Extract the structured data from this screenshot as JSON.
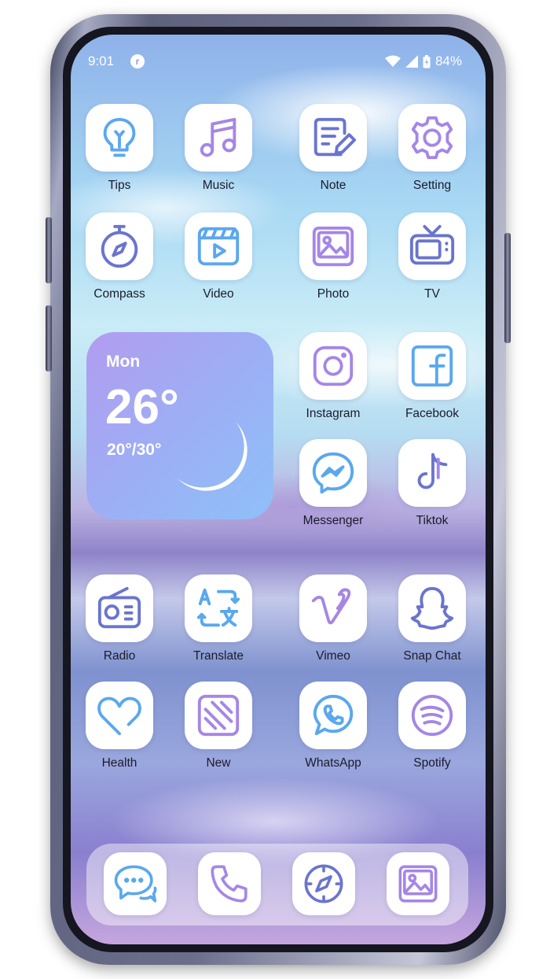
{
  "status_bar": {
    "time": "9:01",
    "notification_icon": "r",
    "battery_percent": "84%"
  },
  "apps": {
    "tips": "Tips",
    "music": "Music",
    "note": "Note",
    "setting": "Setting",
    "compass": "Compass",
    "video": "Video",
    "photo": "Photo",
    "tv": "TV",
    "instagram": "Instagram",
    "facebook": "Facebook",
    "messenger": "Messenger",
    "tiktok": "Tiktok",
    "radio": "Radio",
    "translate": "Translate",
    "vimeo": "Vimeo",
    "snapchat": "Snap Chat",
    "health": "Health",
    "new": "New",
    "whatsapp": "WhatsApp",
    "spotify": "Spotify"
  },
  "weather": {
    "day": "Mon",
    "temperature": "26°",
    "range": "20°/30°"
  },
  "dock": [
    "messages-icon",
    "phone-icon",
    "safari-icon",
    "gallery-icon"
  ],
  "colors": {
    "icon_blue": "#5aa8ee",
    "icon_purple": "#a586e6",
    "icon_indigo": "#6a74cf"
  }
}
